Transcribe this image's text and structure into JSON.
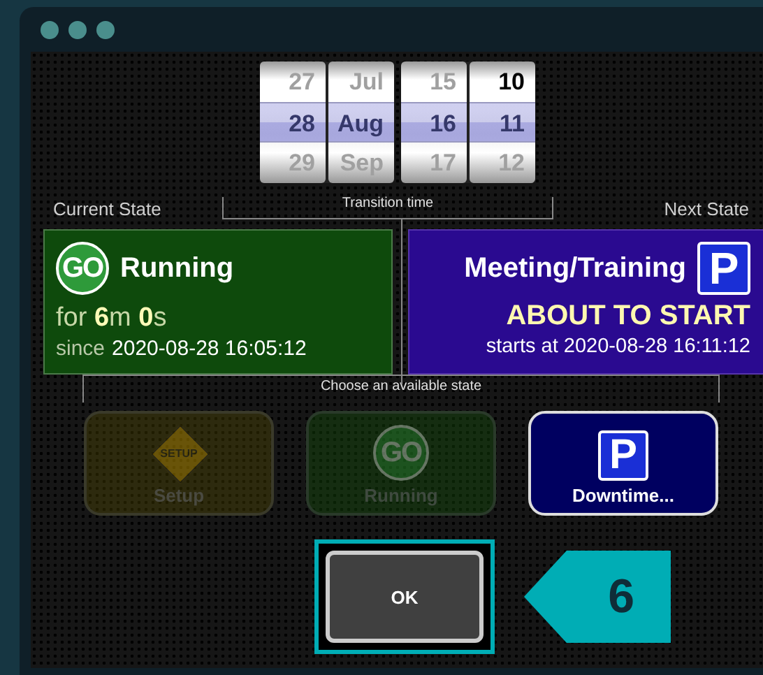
{
  "picker": {
    "columns": [
      {
        "items": [
          {
            "text": "27",
            "selected": false,
            "current": false
          },
          {
            "text": "28",
            "selected": true,
            "current": false
          },
          {
            "text": "29",
            "selected": false,
            "current": false
          }
        ]
      },
      {
        "items": [
          {
            "text": "Jul",
            "selected": false,
            "current": false
          },
          {
            "text": "Aug",
            "selected": true,
            "current": false
          },
          {
            "text": "Sep",
            "selected": false,
            "current": false
          }
        ]
      },
      {
        "items": [
          {
            "text": "15",
            "selected": false,
            "current": false
          },
          {
            "text": "16",
            "selected": true,
            "current": false
          },
          {
            "text": "17",
            "selected": false,
            "current": false
          }
        ]
      },
      {
        "items": [
          {
            "text": "10",
            "selected": false,
            "current": true
          },
          {
            "text": "11",
            "selected": true,
            "current": false
          },
          {
            "text": "12",
            "selected": false,
            "current": false
          }
        ]
      }
    ],
    "caption": "Transition time"
  },
  "current_state": {
    "heading": "Current State",
    "icon_text": "GO",
    "title": "Running",
    "duration": "for **6**m **0**s",
    "since_label": "since",
    "since": "2020-08-28 16:05:12"
  },
  "next_state": {
    "heading": "Next State",
    "title": "Meeting/Training",
    "icon_text": "P",
    "status": "ABOUT TO START",
    "starts": "starts at 2020-08-28 16:11:12"
  },
  "choices": {
    "caption": "Choose an available state",
    "items": [
      {
        "kind": "setup",
        "icon_text": "SETUP",
        "label": "Setup",
        "disabled": true
      },
      {
        "kind": "go",
        "icon_text": "GO",
        "label": "Running",
        "disabled": true
      },
      {
        "kind": "parking",
        "icon_text": "P",
        "label": "Downtime...",
        "disabled": false
      }
    ]
  },
  "ok_button": {
    "label": "OK",
    "highlighted": true
  },
  "callout": {
    "text": "6"
  }
}
